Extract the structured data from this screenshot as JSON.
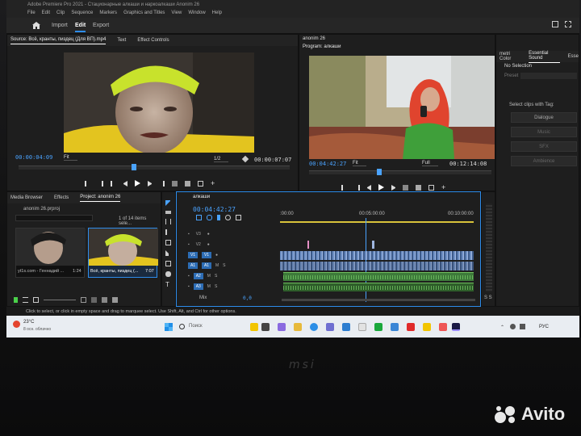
{
  "window": {
    "title": "Adobe Premiere Pro 2021 - Стационарные алкаши и наркоалкаши Anonim 26",
    "menu": [
      "File",
      "Edit",
      "Clip",
      "Sequence",
      "Markers",
      "Graphics and Titles",
      "View",
      "Window",
      "Help"
    ]
  },
  "nav": {
    "tabs": [
      "Import",
      "Edit",
      "Export"
    ],
    "active": "Edit"
  },
  "source": {
    "tabs": [
      "Source: Всё, кранты, пиздец (Для ВП).mp4",
      "Text",
      "Effect Controls"
    ],
    "timecode": "00:00:04:09",
    "fit": "Fit",
    "ratio": "1/2",
    "duration": "00:00:07:07"
  },
  "program": {
    "tab_label": "Program: алкаши",
    "header_label": "anonim 26",
    "timecode": "00:04:42:27",
    "fit": "Fit",
    "quality": "Full",
    "duration": "00:12:14:08"
  },
  "essential": {
    "tabs": [
      "metri Color",
      "Essential Sound",
      "Esse"
    ],
    "no_selection": "No Selection",
    "preset": "Preset",
    "select_label": "Select clips with Tag:",
    "buttons": [
      "Dialogue",
      "Music",
      "SFX",
      "Ambience"
    ]
  },
  "project": {
    "tabs": [
      "Media Browser",
      "Effects",
      "Project: anonim 26"
    ],
    "file": "anonim 26.prproj",
    "count": "1 of 14 items sele...",
    "items": [
      {
        "name": "yt1s.com - Геннадий ...",
        "duration": "1:24"
      },
      {
        "name": "Всё, кранты, пиздец (...",
        "duration": "7:07"
      }
    ]
  },
  "timeline": {
    "sequence": "алкаши",
    "timecode": "00:04:42:27",
    "ruler": [
      ":00:00",
      "00:05:00:00",
      "00:10:00:00"
    ],
    "tracks": [
      "V3",
      "V2",
      "V1",
      "A1",
      "A2",
      "A3"
    ],
    "src_labels": [
      "V1",
      "A1"
    ],
    "mix_label": "Mix",
    "mix_value": "0,0",
    "meter_label": "S S"
  },
  "status": "Click to select, or click in empty space and drag to marquee select. Use Shift, Alt, and Ctrl for other options.",
  "taskbar": {
    "weather_temp": "23°C",
    "weather_desc": "8 осн. облачно",
    "search": "Поиск",
    "lang": "РУС"
  },
  "brand": {
    "laptop": "msi",
    "watermark": "Avito"
  },
  "colors": {
    "accent": "#2d8ceb",
    "timecode": "#4aa3ff",
    "video_clip": "#7b9bd1",
    "audio_clip": "#3d7a3a"
  }
}
